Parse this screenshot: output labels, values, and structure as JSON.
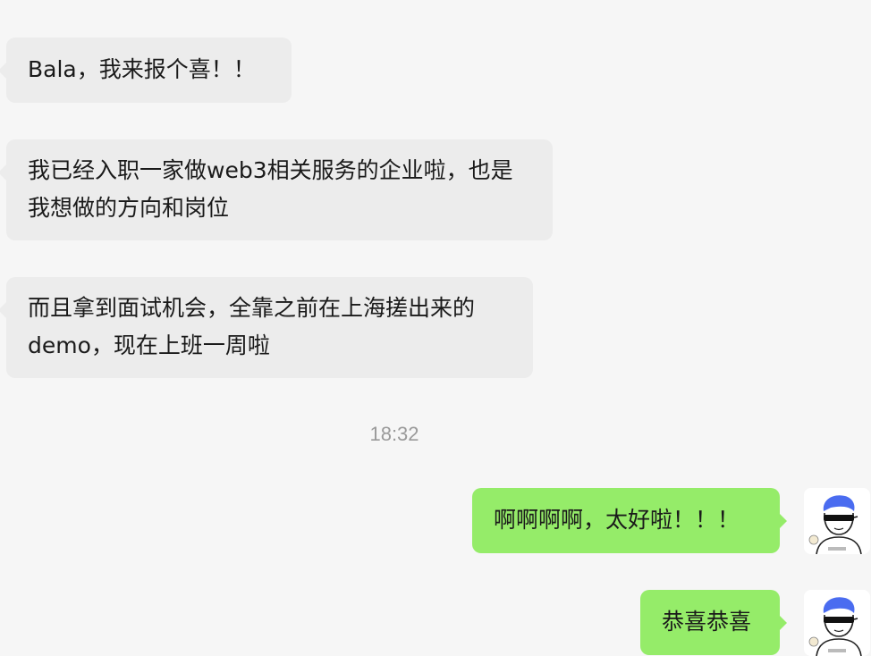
{
  "conversation": {
    "messages_before": [
      {
        "text": "Bala，我来报个喜！！"
      },
      {
        "text": "我已经入职一家做web3相关服务的企业啦，也是我想做的方向和岗位"
      },
      {
        "text": "而且拿到面试机会，全靠之前在上海搓出来的demo，现在上班一周啦"
      }
    ],
    "timestamp": "18:32",
    "messages_after": [
      {
        "text": "啊啊啊啊，太好啦！！！"
      },
      {
        "text": "恭喜恭喜"
      }
    ]
  },
  "colors": {
    "incoming_bubble": "#ececec",
    "outgoing_bubble": "#95ec69",
    "background": "#f6f6f6",
    "timestamp_text": "#9a9a9a"
  },
  "icons": {
    "avatar": "cartoon-avatar-blue-hair-sunglasses"
  }
}
